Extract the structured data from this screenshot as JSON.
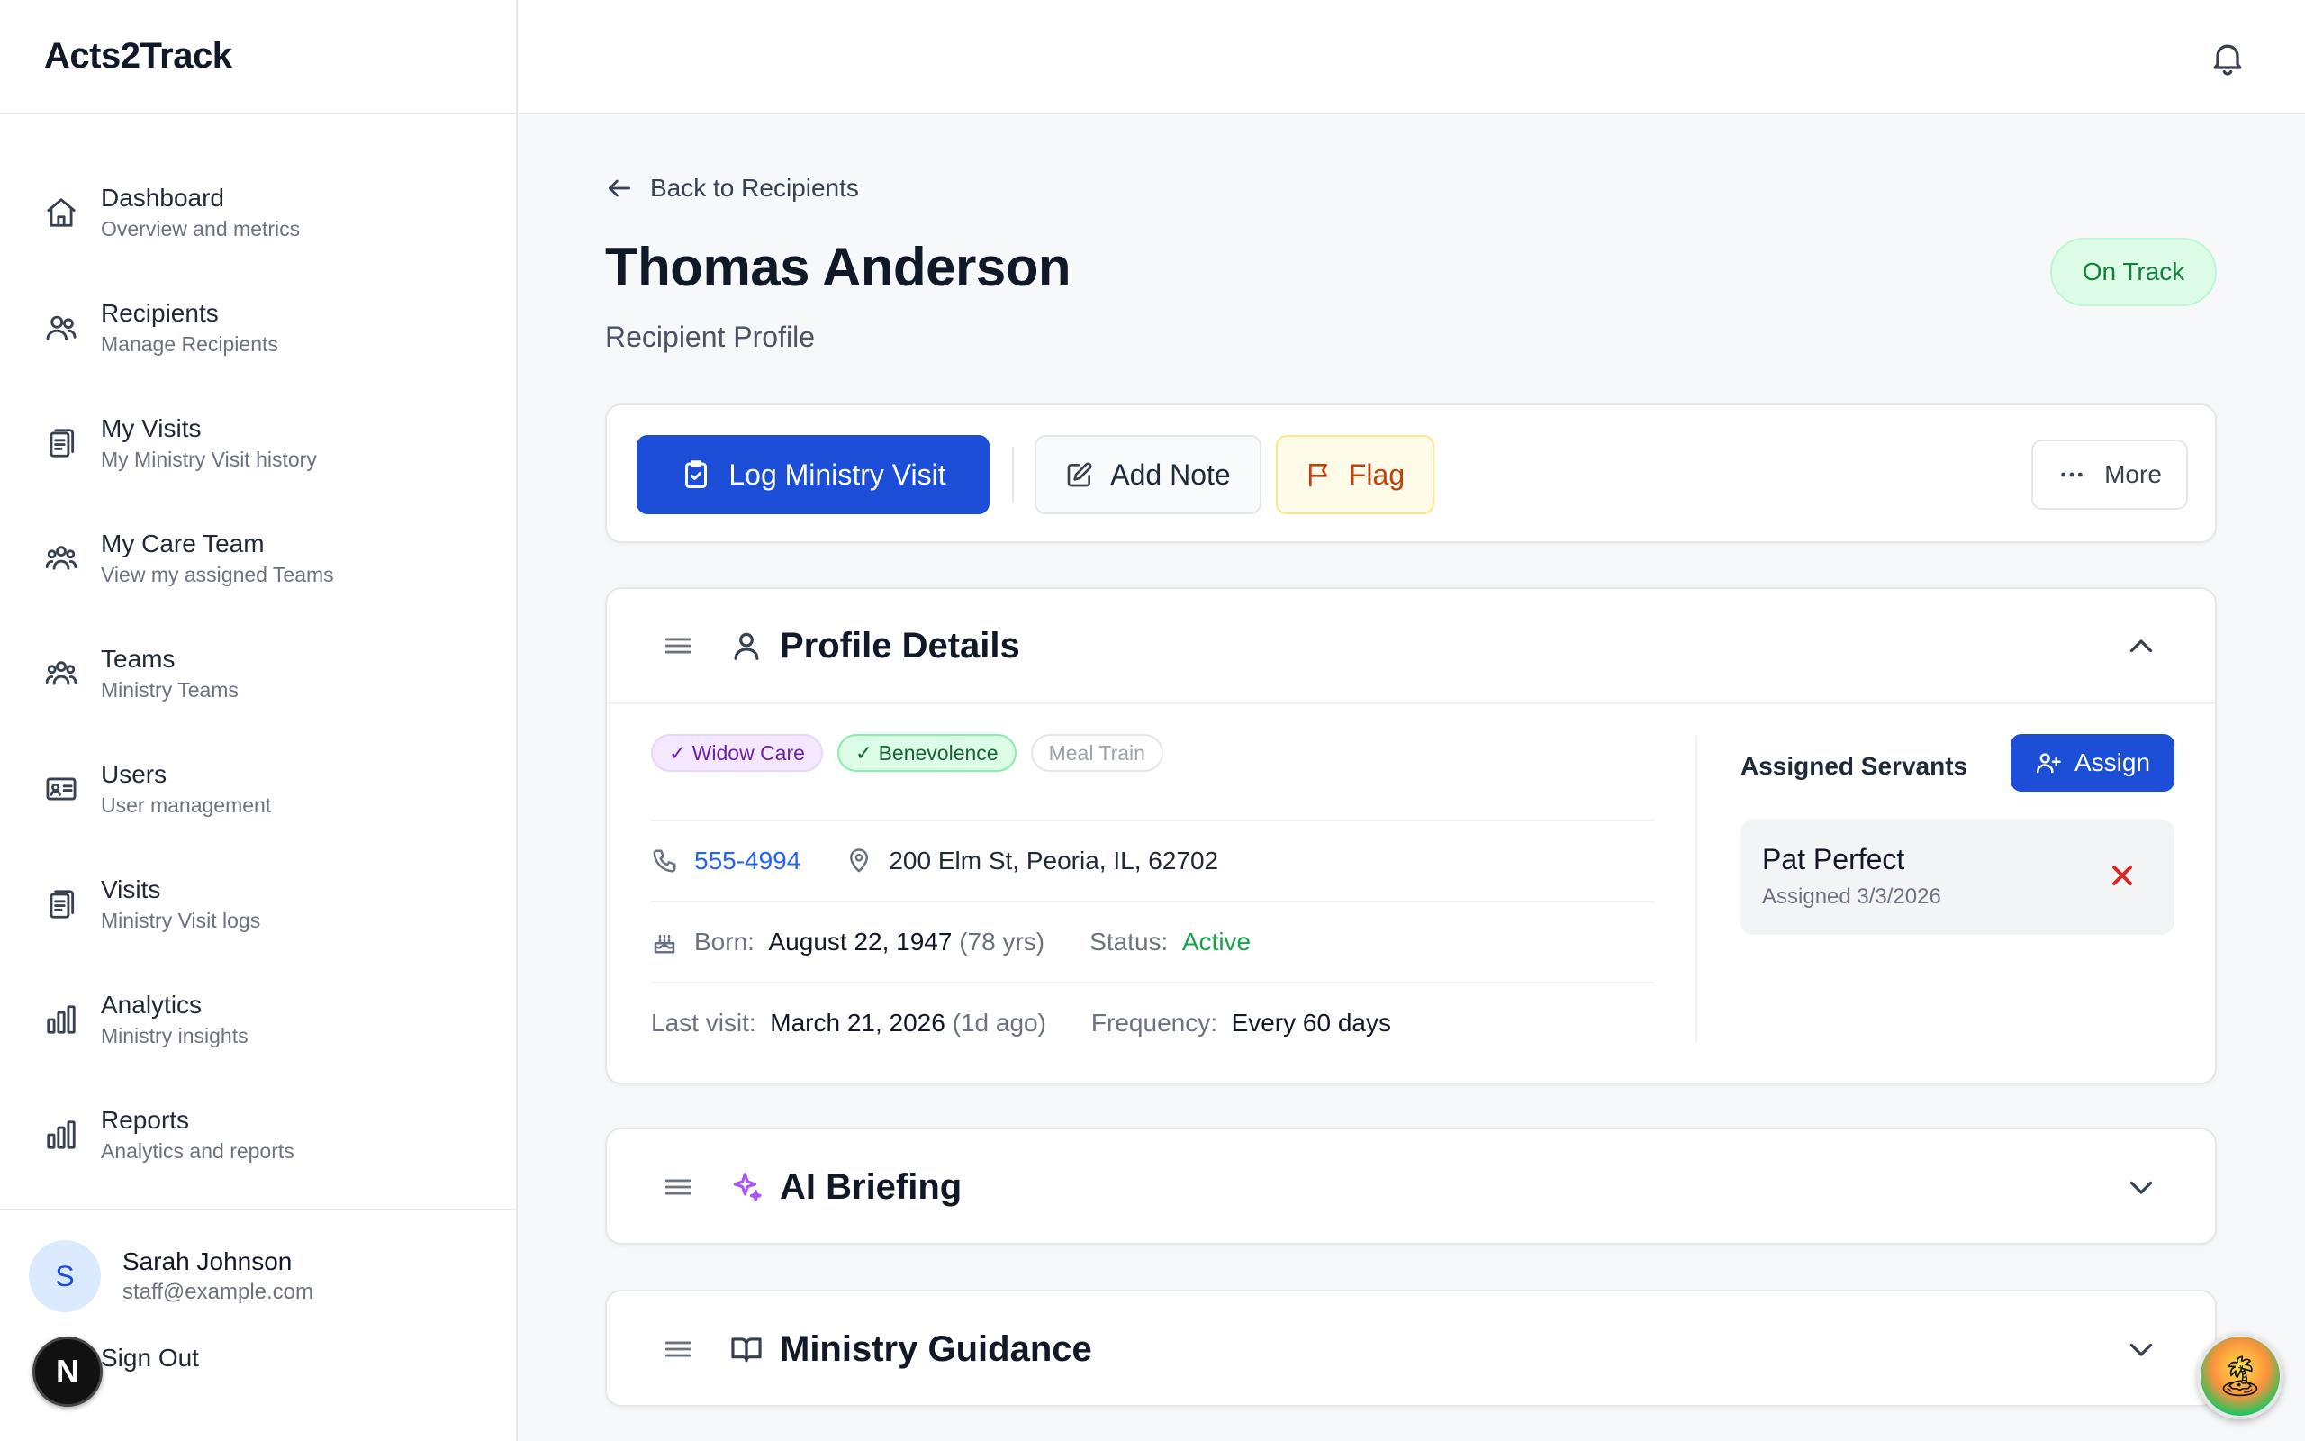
{
  "app": {
    "name": "Acts2Track"
  },
  "sidebar": {
    "items": [
      {
        "label": "Dashboard",
        "sub": "Overview and metrics",
        "icon": "home-icon"
      },
      {
        "label": "Recipients",
        "sub": "Manage Recipients",
        "icon": "users-icon"
      },
      {
        "label": "My Visits",
        "sub": "My Ministry Visit history",
        "icon": "clipboard-icon"
      },
      {
        "label": "My Care Team",
        "sub": "View my assigned Teams",
        "icon": "team-icon"
      },
      {
        "label": "Teams",
        "sub": "Ministry Teams",
        "icon": "team-icon"
      },
      {
        "label": "Users",
        "sub": "User management",
        "icon": "id-card-icon"
      },
      {
        "label": "Visits",
        "sub": "Ministry Visit logs",
        "icon": "clipboard-icon"
      },
      {
        "label": "Analytics",
        "sub": "Ministry insights",
        "icon": "bar-chart-icon"
      },
      {
        "label": "Reports",
        "sub": "Analytics and reports",
        "icon": "bar-chart-icon"
      }
    ],
    "user": {
      "initial": "S",
      "name": "Sarah Johnson",
      "email": "staff@example.com"
    },
    "sign_out": "Sign Out",
    "dev_badge": "N"
  },
  "header": {
    "back_label": "Back to Recipients",
    "title": "Thomas Anderson",
    "subtitle": "Recipient Profile",
    "status": "On Track"
  },
  "actions": {
    "log_visit": "Log Ministry Visit",
    "add_note": "Add Note",
    "flag": "Flag",
    "more": "More"
  },
  "profile": {
    "title": "Profile Details",
    "tags": [
      "✓ Widow Care",
      "✓ Benevolence",
      "Meal Train"
    ],
    "phone": "555-4994",
    "address": "200 Elm St, Peoria, IL, 62702",
    "born_label": "Born:",
    "born_value": "August 22, 1947",
    "born_age": "(78 yrs)",
    "status_label": "Status:",
    "status_value": "Active",
    "last_visit_label": "Last visit:",
    "last_visit_value": "March 21, 2026",
    "last_visit_ago": "(1d ago)",
    "frequency_label": "Frequency:",
    "frequency_value": "Every 60 days",
    "servants_title": "Assigned Servants",
    "assign_label": "Assign",
    "servants": [
      {
        "name": "Pat Perfect",
        "assigned": "Assigned 3/3/2026"
      }
    ]
  },
  "sections": {
    "ai_briefing": "AI Briefing",
    "ministry_guidance": "Ministry Guidance"
  },
  "colors": {
    "primary": "#1d4ed8",
    "success": "#16a34a",
    "danger": "#dc2626",
    "flag": "#c2410c",
    "ai": "#a855f7"
  }
}
